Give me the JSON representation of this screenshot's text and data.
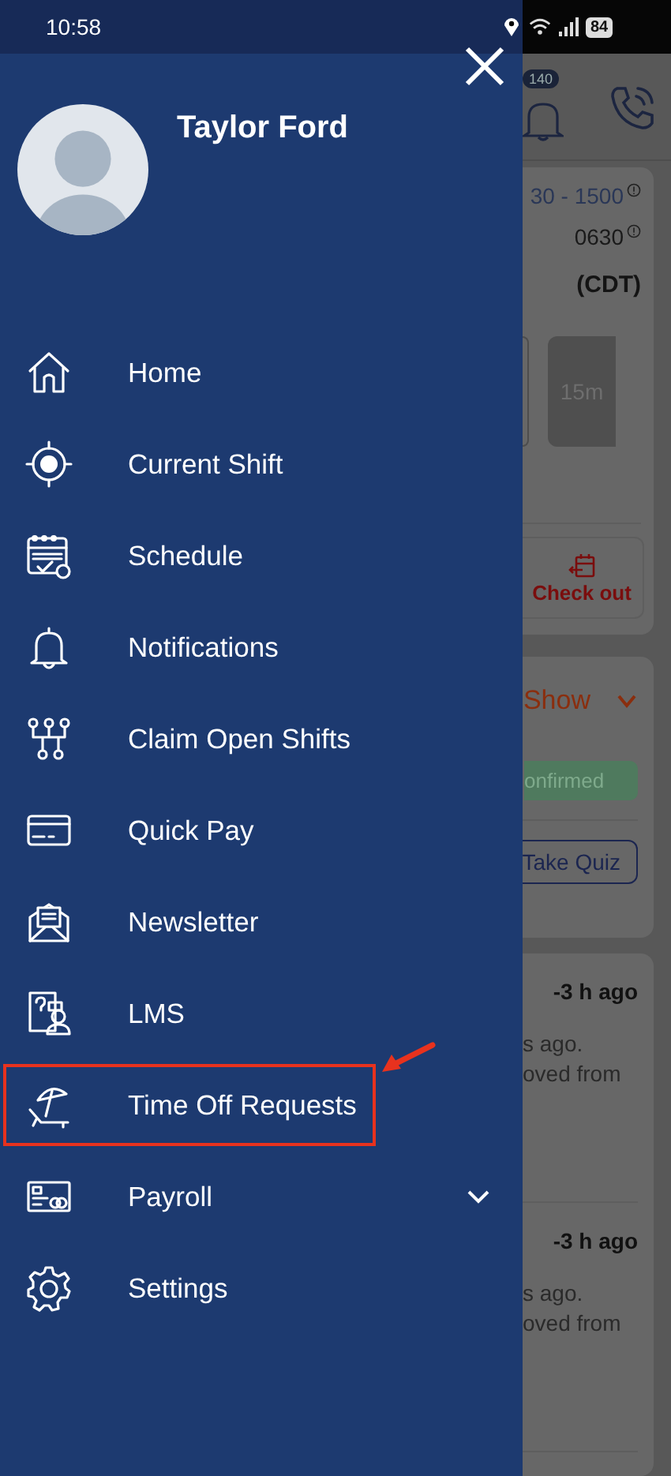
{
  "status_bar": {
    "time": "10:58",
    "battery": "84"
  },
  "drawer": {
    "user_name": "Taylor Ford",
    "items": [
      {
        "label": "Home",
        "highlighted": false,
        "expandable": false
      },
      {
        "label": "Current Shift",
        "highlighted": false,
        "expandable": false
      },
      {
        "label": "Schedule",
        "highlighted": false,
        "expandable": false
      },
      {
        "label": "Notifications",
        "highlighted": false,
        "expandable": false
      },
      {
        "label": "Claim Open Shifts",
        "highlighted": false,
        "expandable": false
      },
      {
        "label": "Quick Pay",
        "highlighted": false,
        "expandable": false
      },
      {
        "label": "Newsletter",
        "highlighted": false,
        "expandable": false
      },
      {
        "label": "LMS",
        "highlighted": false,
        "expandable": false
      },
      {
        "label": "Time Off Requests",
        "highlighted": true,
        "expandable": false
      },
      {
        "label": "Payroll",
        "highlighted": false,
        "expandable": true
      },
      {
        "label": "Settings",
        "highlighted": false,
        "expandable": false
      }
    ]
  },
  "background": {
    "notification_badge": "140",
    "shift_card": {
      "time_range": "30 - 1500",
      "time": "0630",
      "timezone": "(CDT)",
      "break_label": "15m",
      "check_out": "Check out"
    },
    "status_card": {
      "toggle": "Show",
      "badge": "onfirmed",
      "quiz_button": "Take Quiz"
    },
    "notifications": [
      {
        "time": "-3 h ago",
        "lines": [
          "s ago.",
          "oved from"
        ]
      },
      {
        "time": "-3 h ago",
        "lines": [
          "s ago.",
          "oved from"
        ]
      }
    ]
  }
}
